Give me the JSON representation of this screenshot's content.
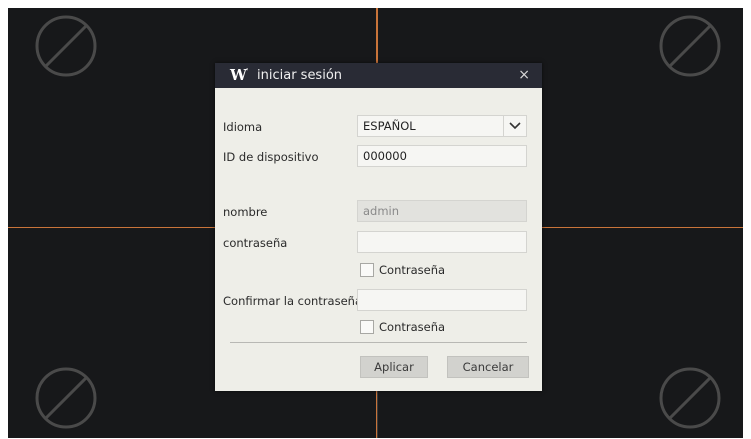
{
  "dialog": {
    "title": "iniciar sesión",
    "logo": "W",
    "close_glyph": "×",
    "language_label": "Idioma",
    "language_value": "ESPAÑOL",
    "device_id_label": "ID de dispositivo",
    "device_id_value": "000000",
    "name_label": "nombre",
    "name_value": "admin",
    "password_label": "contraseña",
    "password_value": "",
    "show_password_label": "Contraseña",
    "confirm_label": "Confirmar la contraseña",
    "confirm_value": "",
    "show_confirm_label": "Contraseña",
    "apply_label": "Aplicar",
    "cancel_label": "Cancelar"
  },
  "icons": {
    "no_video": "no-video-icon",
    "dropdown": "chevron-down-icon",
    "close": "close-icon"
  },
  "colors": {
    "background": "#17181a",
    "divider": "#c9743a",
    "titlebar": "#292b35",
    "dialog": "#eeeee8"
  }
}
